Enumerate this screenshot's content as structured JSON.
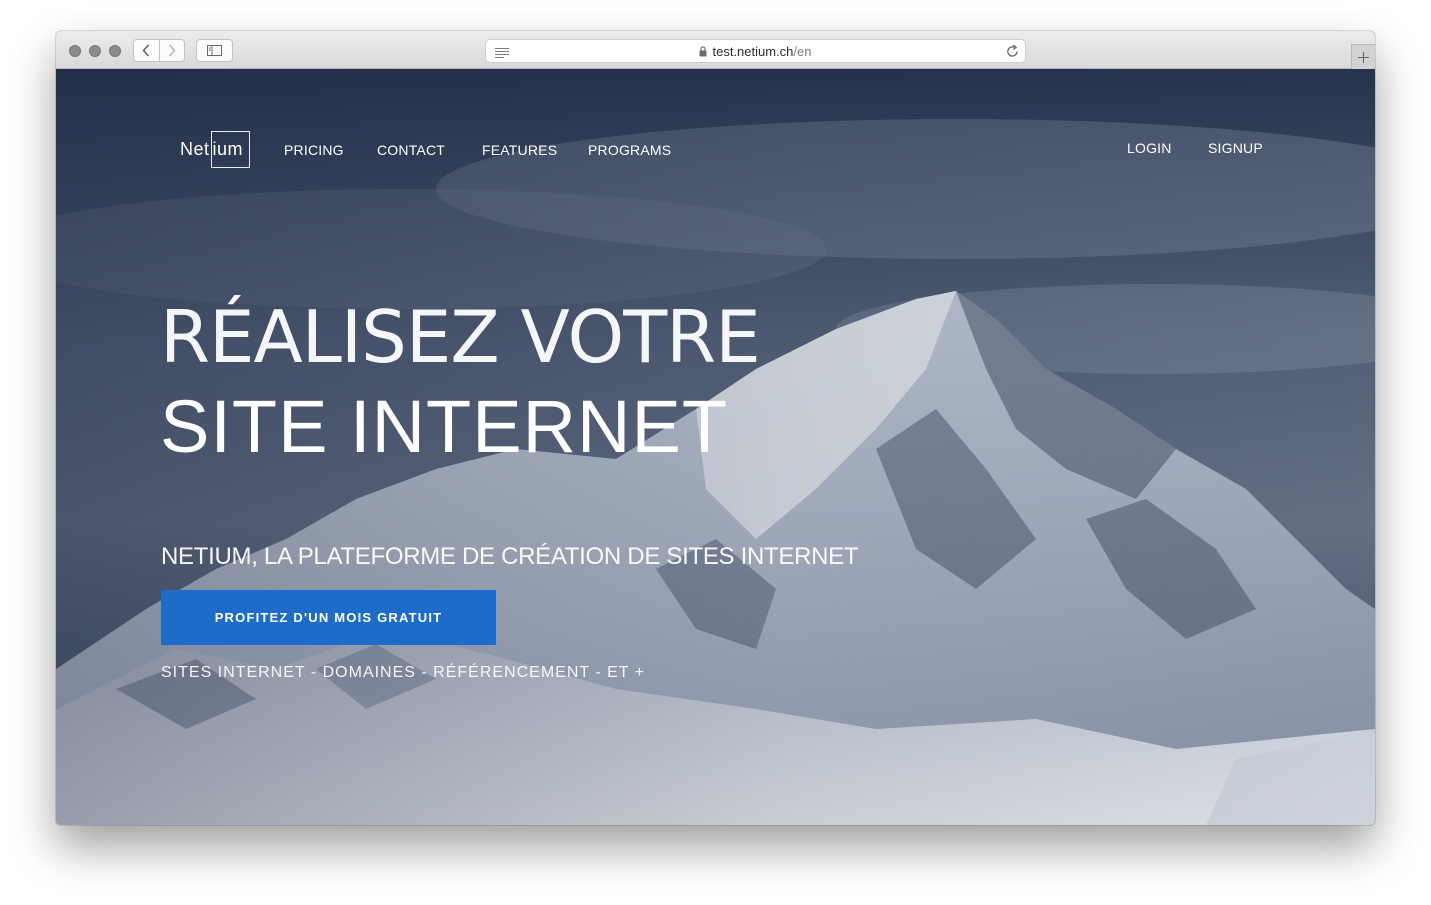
{
  "browser": {
    "url_host": "test.netium.ch",
    "url_path": "/en"
  },
  "site": {
    "logo_part1": "Net",
    "logo_part2": "ium",
    "nav": [
      "PRICING",
      "CONTACT",
      "FEATURES",
      "PROGRAMS"
    ],
    "login": "LOGIN",
    "signup": "SIGNUP"
  },
  "hero": {
    "headline_line1": "RÉALISEZ VOTRE",
    "headline_line2": "SITE INTERNET",
    "subtitle": "NETIUM, LA PLATEFORME DE CRÉATION DE SITES INTERNET",
    "cta_label": "PROFITEZ D'UN MOIS GRATUIT",
    "tagline": "SITES INTERNET - DOMAINES - RÉFÉRENCEMENT - ET +",
    "cta_color": "#1d6cc9"
  }
}
